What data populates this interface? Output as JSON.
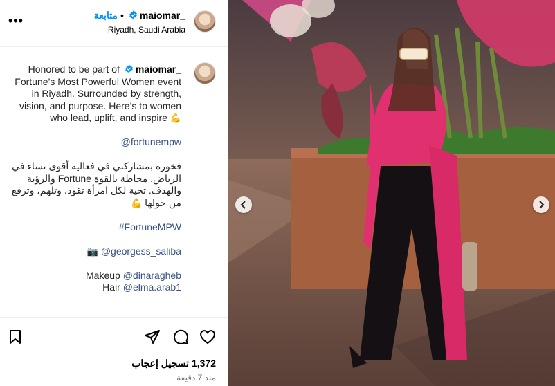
{
  "header": {
    "follow_label": "متابعة",
    "username": "maiomar_",
    "location": "Riyadh, Saudi Arabia",
    "more_label": "•••"
  },
  "caption": {
    "username": "maiomar_",
    "text_en": "Honored to be part of Fortune’s Most Powerful Women event in Riyadh. Surrounded by strength, vision, and purpose. Here’s to women who lead, uplift, and inspire",
    "mention_fortune": "@fortunempw",
    "text_ar": "فخورة بمشاركتي في فعالية أقوى نساء في الرياض. محاطة بالقوة Fortune والرؤية والهدف. تحية لكل امرأة تقود، وتلهم، وترفع من حولها",
    "hashtag": "#FortuneMPW",
    "photo_credit": "@georgess_saliba",
    "makeup_label": "Makeup",
    "makeup_handle": "@dinaragheb",
    "hair_label": "Hair",
    "hair_handle": "@elma.arab1"
  },
  "stats": {
    "likes": "1,372 تسجيل إعجاب",
    "time_ago": "منذ 7 دقيقة"
  },
  "icons": {
    "save": "bookmark-icon",
    "share": "paper-plane-icon",
    "comment": "comment-icon",
    "like": "heart-icon",
    "verified": "verified-badge-icon",
    "camera": "camera-icon",
    "muscle": "flexed-biceps-icon",
    "prev": "chevron-left-icon",
    "next": "chevron-right-icon"
  },
  "colors": {
    "link": "#385185",
    "follow": "#0095f6",
    "verified": "#0095f6",
    "dress": "#e0306f"
  }
}
